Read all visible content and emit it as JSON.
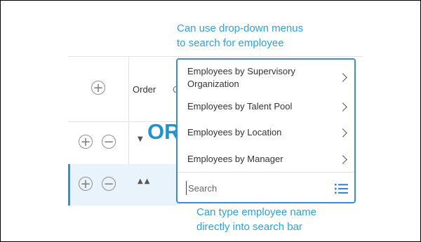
{
  "annotations": {
    "top_line1": "Can use drop-down menus",
    "top_line2": "to search for employee",
    "or_text": "OR",
    "bottom_line1": "Can type employee name",
    "bottom_line2": "directly into search bar"
  },
  "table": {
    "header_order": "Order",
    "header_partial": "C",
    "add_symbol": "+",
    "remove_symbol": "−",
    "sort_up": "▲",
    "sort_down": "▼"
  },
  "dropdown": {
    "items": [
      {
        "label": "Employees by Supervisory Organization"
      },
      {
        "label": "Employees by Talent Pool"
      },
      {
        "label": "Employees by Location"
      },
      {
        "label": "Employees by Manager"
      }
    ],
    "search_placeholder": "Search"
  },
  "colors": {
    "annotation": "#2aa3df",
    "dropdown_border": "#3e8bd4",
    "selected_row": "#e8f3fb",
    "list_icon": "#2b7fd4"
  }
}
